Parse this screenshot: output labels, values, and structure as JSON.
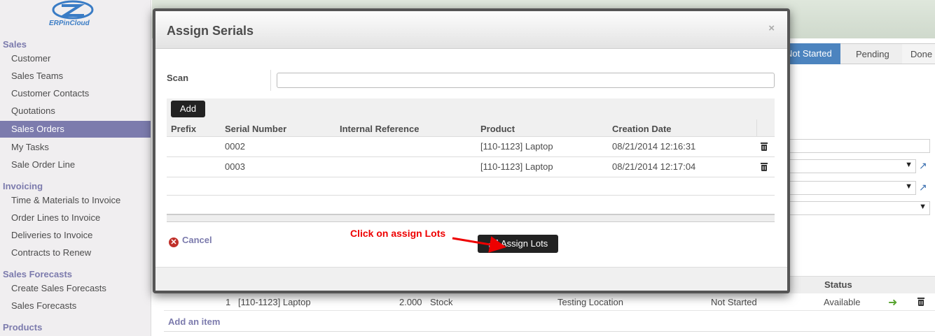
{
  "logo": {
    "text": "ERPinCloud"
  },
  "sidebar": {
    "sections": [
      {
        "label": "Sales",
        "items": [
          "Customer",
          "Sales Teams",
          "Customer Contacts",
          "Quotations",
          "Sales Orders",
          "My Tasks",
          "Sale Order Line"
        ]
      },
      {
        "label": "Invoicing",
        "items": [
          "Time & Materials to Invoice",
          "Order Lines to Invoice",
          "Deliveries to Invoice",
          "Contracts to Renew"
        ]
      },
      {
        "label": "Sales Forecasts",
        "items": [
          "Create Sales Forecasts",
          "Sales Forecasts"
        ]
      },
      {
        "label": "Products",
        "items": []
      }
    ],
    "active_item": "Sales Orders"
  },
  "statusbar": {
    "stages": [
      "Not Started",
      "Pending",
      "Done"
    ],
    "active": "Not Started"
  },
  "background_table": {
    "status_header": "Status",
    "row": {
      "seq": "1",
      "product": "[110-1123] Laptop",
      "qty": "2.000",
      "location_src": "Stock",
      "location_dest": "Testing Location",
      "state": "Not Started",
      "status": "Available"
    },
    "add_item": "Add an item"
  },
  "modal": {
    "title": "Assign Serials",
    "close": "×",
    "scan_label": "Scan",
    "scan_value": "",
    "add_button": "Add",
    "columns": [
      "Prefix",
      "Serial Number",
      "Internal Reference",
      "Product",
      "Creation Date"
    ],
    "rows": [
      {
        "prefix": "",
        "serial": "0002",
        "internal_ref": "",
        "product": "[110-1123] Laptop",
        "date": "08/21/2014 12:16:31"
      },
      {
        "prefix": "",
        "serial": "0003",
        "internal_ref": "",
        "product": "[110-1123] Laptop",
        "date": "08/21/2014 12:17:04"
      }
    ],
    "cancel_label": "Cancel",
    "assign_label": "Assign Lots",
    "annotation": "Click on assign Lots"
  },
  "colors": {
    "accent": "#7c7bad",
    "stage_active": "#4c84bf",
    "annotation": "#ee0000",
    "cancel_icon": "#c0302a"
  }
}
